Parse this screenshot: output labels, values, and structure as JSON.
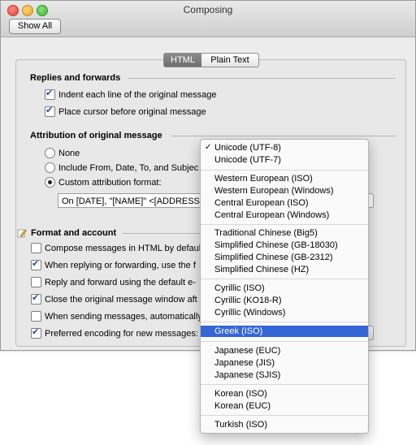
{
  "window": {
    "title": "Composing"
  },
  "toolbar": {
    "show_all_label": "Show All"
  },
  "tabs": [
    {
      "label": "HTML"
    },
    {
      "label": "Plain Text"
    }
  ],
  "replies": {
    "heading": "Replies and forwards",
    "indent_label": "Indent each line of the original message",
    "cursor_label": "Place cursor before original message"
  },
  "attribution": {
    "heading": "Attribution of original message",
    "none_label": "None",
    "include_label": "Include From, Date, To, and Subjec",
    "custom_label": "Custom attribution format:",
    "format_value": "On [DATE], \"[NAME]\" <[ADDRESS]>"
  },
  "format_account": {
    "heading": "Format and account",
    "items": [
      {
        "label": "Compose messages in HTML by defaul",
        "checked": false
      },
      {
        "label": "When replying or forwarding, use the f",
        "checked": true
      },
      {
        "label": "Reply and forward using the default e-",
        "checked": false
      },
      {
        "label": "Close the original message window aft",
        "checked": true
      },
      {
        "label": "When sending messages, automatically",
        "checked": false
      },
      {
        "label": "Preferred encoding for new messages:",
        "checked": true
      }
    ]
  },
  "encoding_menu": {
    "checked_mark": "✓",
    "items": [
      "Unicode (UTF-8)",
      "Unicode (UTF-7)",
      "Western European (ISO)",
      "Western European (Windows)",
      "Central European (ISO)",
      "Central European (Windows)",
      "Traditional Chinese (Big5)",
      "Simplified Chinese (GB-18030)",
      "Simplified Chinese (GB-2312)",
      "Simplified Chinese (HZ)",
      "Cyrillic (ISO)",
      "Cyrillic (KO18-R)",
      "Cyrillic (Windows)",
      "Greek (ISO)",
      "Japanese (EUC)",
      "Japanese (JIS)",
      "Japanese (SJIS)",
      "Korean (ISO)",
      "Korean (EUC)",
      "Turkish (ISO)"
    ],
    "checked_item": "Unicode (UTF-8)",
    "highlighted_item": "Greek (ISO)"
  },
  "colors": {
    "highlight": "#3466d6",
    "checkmark": "#1c4fae"
  }
}
